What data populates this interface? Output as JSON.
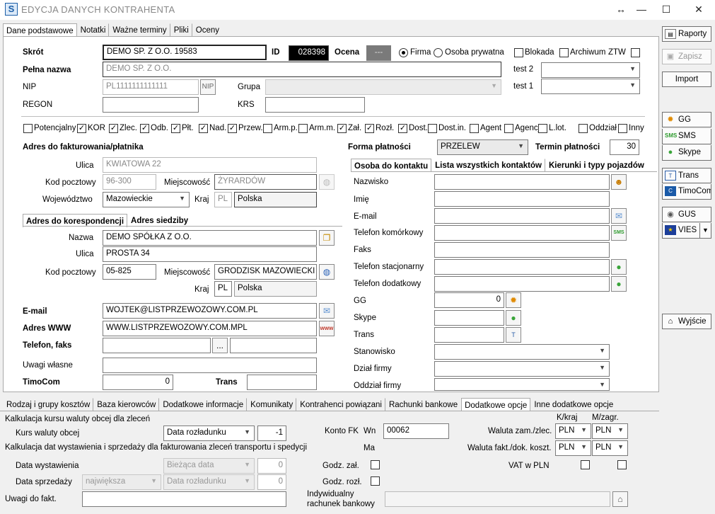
{
  "window": {
    "title": "EDYCJA DANYCH KONTRAHENTA",
    "app_icon": "S",
    "resize_glyph": "↔",
    "min_glyph": "—",
    "max_glyph": "☐",
    "close_glyph": "✕"
  },
  "top_tabs": [
    "Dane podstawowe",
    "Notatki",
    "Ważne terminy",
    "Pliki",
    "Oceny"
  ],
  "side": {
    "raporty": "Raporty",
    "zapisz": "Zapisz",
    "import": "Import",
    "gg": "GG",
    "sms": "SMS",
    "skype": "Skype",
    "trans": "Trans",
    "timocom": "TimoCom",
    "gus": "GUS",
    "vies": "VIES",
    "wyjscie": "Wyjście"
  },
  "head": {
    "skrot_label": "Skrót",
    "skrot": "DEMO SP. Z O.O. 19583",
    "id_label": "ID",
    "id": "028398",
    "ocena_label": "Ocena",
    "ocena": "---",
    "firma": "Firma",
    "osoba": "Osoba prywatna",
    "blokada": "Blokada",
    "archiwum": "Archiwum",
    "ztw": "ZTW",
    "pelna_label": "Pełna nazwa",
    "pelna": "DEMO SP. Z O.O.",
    "test2": "test 2",
    "test1": "test 1",
    "nip_label": "NIP",
    "nip": "PL1111111111111",
    "nip_btn": "NIP",
    "grupa_label": "Grupa",
    "regon_label": "REGON",
    "krs_label": "KRS"
  },
  "flags": [
    {
      "label": "Potencjalny",
      "checked": false
    },
    {
      "label": "KOR",
      "checked": true
    },
    {
      "label": "Zlec.",
      "checked": true
    },
    {
      "label": "Odb.",
      "checked": true
    },
    {
      "label": "Płt.",
      "checked": true
    },
    {
      "label": "Nad.",
      "checked": true
    },
    {
      "label": "Przew.",
      "checked": true
    },
    {
      "label": "Arm.p.",
      "checked": false
    },
    {
      "label": "Arm.m.",
      "checked": false
    },
    {
      "label": "Zał.",
      "checked": true
    },
    {
      "label": "Rozł.",
      "checked": true
    },
    {
      "label": "Dost.",
      "checked": true
    },
    {
      "label": "Dost.in.",
      "checked": false
    },
    {
      "label": "Agent",
      "checked": false
    },
    {
      "label": "Agencja",
      "checked": false
    },
    {
      "label": "L.lot.",
      "checked": false
    },
    {
      "label": "Oddział",
      "checked": false
    },
    {
      "label": "Inny",
      "checked": false
    }
  ],
  "faktura": {
    "header": "Adres do fakturowania/płatnika",
    "ulica_label": "Ulica",
    "ulica": "KWIATOWA 22",
    "kod_label": "Kod pocztowy",
    "kod": "96-300",
    "miejsc_label": "Miejscowość",
    "miejsc": "ŻYRARDÓW",
    "woj_label": "Województwo",
    "woj": "Mazowieckie",
    "kraj_label": "Kraj",
    "kraj_code": "PL",
    "kraj": "Polska"
  },
  "kor": {
    "tabs": [
      "Adres do korespondencji",
      "Adres siedziby"
    ],
    "nazwa_label": "Nazwa",
    "nazwa": "DEMO SPÓŁKA Z O.O.",
    "ulica_label": "Ulica",
    "ulica": "PROSTA 34",
    "kod_label": "Kod pocztowy",
    "kod": "05-825",
    "miejsc_label": "Miejscowość",
    "miejsc": "GRODZISK MAZOWIECKI",
    "kraj_label": "Kraj",
    "kraj_code": "PL",
    "kraj": "Polska"
  },
  "contact": {
    "email_label": "E-mail",
    "email": "WOJTEK@LISTPRZEWOZOWY.COM.PL",
    "www_label": "Adres WWW",
    "www": "WWW.LISTPRZEWOZOWY.COM.MPL",
    "tel_label": "Telefon, faks",
    "tel_btn": "...",
    "uwagi_label": "Uwagi własne",
    "timocom_label": "TimoCom",
    "timocom": "0",
    "trans_label": "Trans"
  },
  "platnosc": {
    "forma_label": "Forma płatności",
    "forma": "PRZELEW",
    "termin_label": "Termin płatności",
    "termin": "30"
  },
  "osoba_tabs": [
    "Osoba do kontaktu",
    "Lista wszystkich kontaktów",
    "Kierunki i typy pojazdów"
  ],
  "osoba": {
    "nazwisko": "Nazwisko",
    "imie": "Imię",
    "email": "E-mail",
    "kom": "Telefon komórkowy",
    "faks": "Faks",
    "stac": "Telefon stacjonarny",
    "dod": "Telefon dodatkowy",
    "gg": "GG",
    "gg_val": "0",
    "skype": "Skype",
    "trans": "Trans",
    "stanowisko": "Stanowisko",
    "dzial": "Dział firmy",
    "oddzial": "Oddział firmy"
  },
  "bottom_tabs": [
    "Rodzaj i grupy kosztów",
    "Baza kierowców",
    "Dodatkowe informacje",
    "Komunikaty",
    "Kontrahenci powiązani",
    "Rachunki bankowe",
    "Dodatkowe opcje",
    "Inne dodatkowe opcje"
  ],
  "opcje": {
    "kalk_kurs": "Kalkulacja kursu waluty obcej dla zleceń",
    "kurs_label": "Kurs waluty obcej",
    "kurs_sel": "Data rozładunku",
    "kurs_val": "-1",
    "kalk_dat": "Kalkulacja dat wystawienia i sprzedaży dla fakturowania zleceń transportu i spedycji",
    "data_wyst_label": "Data wystawienia",
    "data_wyst_sel": "Bieżąca data",
    "data_wyst_val": "0",
    "data_sprz_label": "Data sprzedaży",
    "data_sprz_sel1": "największa",
    "data_sprz_sel2": "Data rozładunku",
    "data_sprz_val": "0",
    "uwagi_label": "Uwagi do fakt.",
    "konto_label": "Konto FK",
    "wn_label": "Wn",
    "wn": "00062",
    "ma_label": "Ma",
    "godz_zal": "Godz. zał.",
    "godz_rozl": "Godz. rozł.",
    "indyw_label1": "Indywidualny",
    "indyw_label2": "rachunek bankowy",
    "kkraj": "K/kraj",
    "mzagr": "M/zagr.",
    "waluta_zam": "Waluta zam./zlec.",
    "waluta_fakt": "Waluta fakt./dok. koszt.",
    "vat": "VAT w PLN",
    "pln": "PLN"
  }
}
